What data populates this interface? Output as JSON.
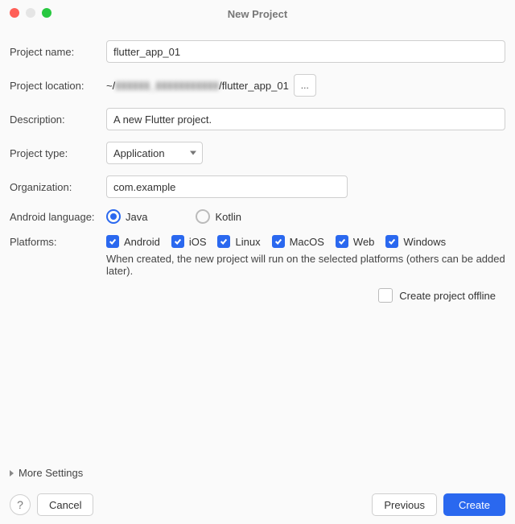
{
  "window": {
    "title": "New Project"
  },
  "labels": {
    "project_name": "Project name:",
    "project_location": "Project location:",
    "description": "Description:",
    "project_type": "Project type:",
    "organization": "Organization:",
    "android_language": "Android language:",
    "platforms": "Platforms:"
  },
  "fields": {
    "project_name": "flutter_app_01",
    "project_location_prefix": "~/",
    "project_location_obscured": "▮▮▮▮▮▮_▮▮▮▮▮▮▮▮▮▮▮",
    "project_location_suffix": "/flutter_app_01",
    "description": "A new Flutter project.",
    "project_type": "Application",
    "organization": "com.example"
  },
  "browse_label": "...",
  "android_language": {
    "options": [
      {
        "value": "java",
        "label": "Java",
        "selected": true
      },
      {
        "value": "kotlin",
        "label": "Kotlin",
        "selected": false
      }
    ]
  },
  "platforms": {
    "options": [
      {
        "value": "android",
        "label": "Android",
        "checked": true
      },
      {
        "value": "ios",
        "label": "iOS",
        "checked": true
      },
      {
        "value": "linux",
        "label": "Linux",
        "checked": true
      },
      {
        "value": "macos",
        "label": "MacOS",
        "checked": true
      },
      {
        "value": "web",
        "label": "Web",
        "checked": true
      },
      {
        "value": "windows",
        "label": "Windows",
        "checked": true
      }
    ],
    "note": "When created, the new project will run on the selected platforms (others can be added later)."
  },
  "offline": {
    "label": "Create project offline",
    "checked": false
  },
  "more_settings": "More Settings",
  "buttons": {
    "help": "?",
    "cancel": "Cancel",
    "previous": "Previous",
    "create": "Create"
  }
}
